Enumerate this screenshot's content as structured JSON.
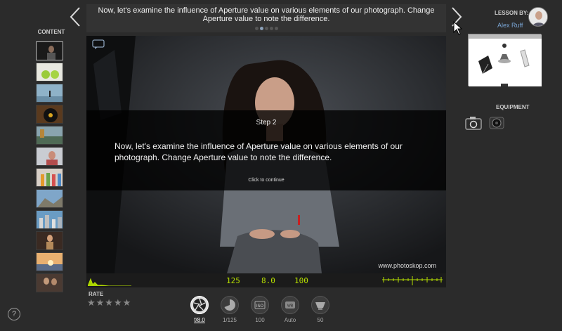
{
  "header": {
    "instruction": "Now, let's examine the influence of Aperture value on various elements of our photograph. Change Aperture value to note the difference."
  },
  "nav": {
    "prev_icon": "chevron-left-icon",
    "next_icon": "chevron-right-icon"
  },
  "sidebar": {
    "label": "CONTENT",
    "thumb_count": 12,
    "active_index": 0
  },
  "stage": {
    "step_title": "Step 2",
    "step_text": "Now, let's examine the influence of Aperture value on various elements of our photograph. Change Aperture value to note the difference.",
    "continue": "Click to continue",
    "watermark": "www.photoskop.com"
  },
  "meter": {
    "shutter": "125",
    "aperture": "8.0",
    "iso": "100"
  },
  "rate": {
    "label": "RATE",
    "stars": "★★★★★"
  },
  "controls": [
    {
      "icon": "aperture-icon",
      "label": "f/8.0",
      "active": true
    },
    {
      "icon": "shutter-speed-icon",
      "label": "1/125",
      "active": false
    },
    {
      "icon": "iso-icon",
      "label": "100",
      "active": false
    },
    {
      "icon": "white-balance-icon",
      "label": "Auto",
      "active": false
    },
    {
      "icon": "focal-length-icon",
      "label": "50",
      "active": false
    }
  ],
  "right": {
    "lesson_label": "LESSON BY:",
    "author": "Alex Ruff",
    "equipment_label": "EQUIPMENT"
  },
  "help": {
    "label": "?"
  },
  "colors": {
    "accent_green": "#b7e000",
    "link_blue": "#7aa6d6",
    "background": "#2b2b2b"
  }
}
